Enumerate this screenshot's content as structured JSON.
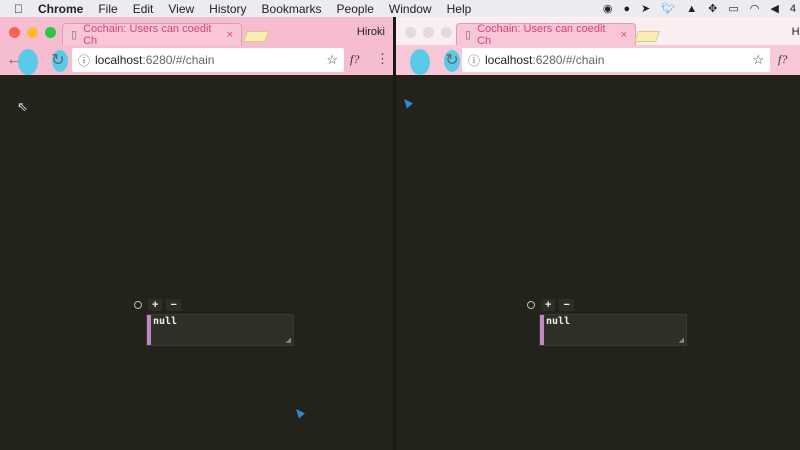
{
  "menubar": {
    "app": "Chrome",
    "items": [
      "File",
      "Edit",
      "View",
      "History",
      "Bookmarks",
      "People",
      "Window",
      "Help"
    ],
    "battery": "4"
  },
  "windows": [
    {
      "tab_title": "Cochain: Users can coedit Ch",
      "user": "Hiroki",
      "url_host": "localhost",
      "url_rest": ":6280/#/chain",
      "ext": "f?",
      "node": {
        "add": "+",
        "remove": "−",
        "value": "null"
      }
    },
    {
      "tab_title": "Cochain: Users can coedit Ch",
      "user": "Hi",
      "url_host": "localhost",
      "url_rest": ":6280/#/chain",
      "ext": "f?",
      "node": {
        "add": "+",
        "remove": "−",
        "value": "null"
      }
    }
  ],
  "colors": {
    "tab_bg": "#f6bcd0",
    "content_bg": "#23231c",
    "accent": "#e0407a",
    "cursor": "#2a8ad8"
  }
}
